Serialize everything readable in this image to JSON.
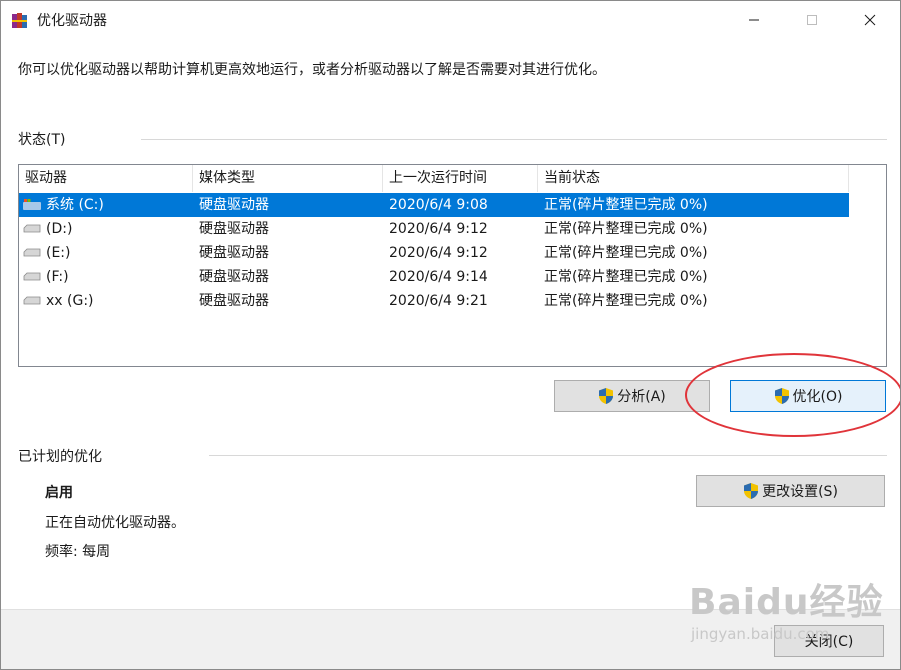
{
  "window": {
    "title": "优化驱动器"
  },
  "intro": "你可以优化驱动器以帮助计算机更高效地运行，或者分析驱动器以了解是否需要对其进行优化。",
  "status_section": {
    "label": "状态(T)"
  },
  "table": {
    "columns": [
      "驱动器",
      "媒体类型",
      "上一次运行时间",
      "当前状态"
    ],
    "rows": [
      {
        "drive": "系统 (C:)",
        "media": "硬盘驱动器",
        "last_run": "2020/6/4 9:08",
        "status": "正常(碎片整理已完成 0%)",
        "selected": true
      },
      {
        "drive": "(D:)",
        "media": "硬盘驱动器",
        "last_run": "2020/6/4 9:12",
        "status": "正常(碎片整理已完成 0%)"
      },
      {
        "drive": "(E:)",
        "media": "硬盘驱动器",
        "last_run": "2020/6/4 9:12",
        "status": "正常(碎片整理已完成 0%)"
      },
      {
        "drive": "(F:)",
        "media": "硬盘驱动器",
        "last_run": "2020/6/4 9:14",
        "status": "正常(碎片整理已完成 0%)"
      },
      {
        "drive": "xx (G:)",
        "media": "硬盘驱动器",
        "last_run": "2020/6/4 9:21",
        "status": "正常(碎片整理已完成 0%)"
      }
    ]
  },
  "buttons": {
    "analyze": "分析(A)",
    "optimize": "优化(O)",
    "change_settings": "更改设置(S)",
    "close": "关闭(C)"
  },
  "scheduled": {
    "label": "已计划的优化",
    "state": "启用",
    "description": "正在自动优化驱动器。",
    "frequency": "频率: 每周"
  },
  "watermark": {
    "text": "Baidu经验",
    "sub": "jingyan.baidu.com"
  },
  "colors": {
    "selection": "#0078d7",
    "highlight_circle": "#e0343a",
    "button_focus": "#e5f1fb"
  }
}
